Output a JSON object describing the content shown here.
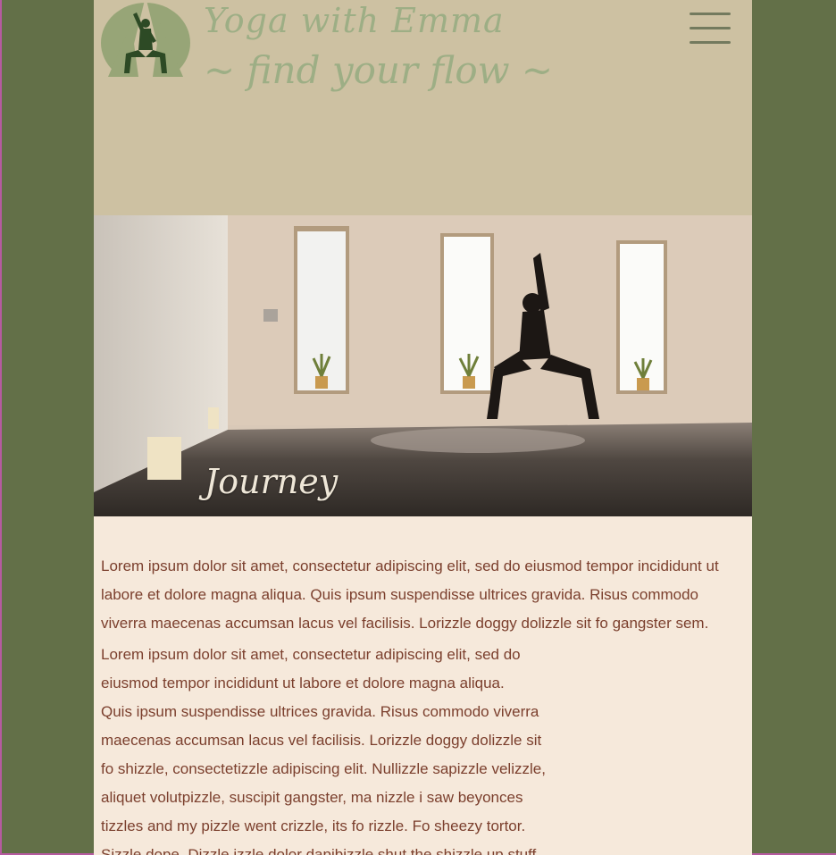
{
  "site": {
    "title": "Yoga with Emma",
    "tagline": "~ find your flow ~"
  },
  "header": {
    "logo_icon": "yoga-figure-mountain-logo",
    "menu_icon": "hamburger-icon"
  },
  "hero": {
    "caption": "Journey"
  },
  "content": {
    "paragraph_1": "Lorem ipsum dolor sit amet, consectetur adipiscing elit, sed do eiusmod tempor incididunt ut labore et dolore magna aliqua. Quis ipsum suspendisse ultrices gravida. Risus commodo viverra maecenas accumsan lacus vel facilisis. Lorizzle doggy dolizzle sit fo gangster sem.",
    "paragraph_2_lines": [
      "Lorem ipsum dolor sit amet, consectetur adipiscing elit, sed do",
      "eiusmod tempor incididunt ut labore et dolore magna aliqua.",
      "Quis ipsum suspendisse ultrices gravida. Risus commodo viverra",
      "maecenas accumsan lacus vel facilisis. Lorizzle doggy dolizzle sit",
      "fo shizzle, consectetizzle adipiscing elit. Nullizzle sapizzle velizzle,",
      "aliquet volutpizzle, suscipit gangster, ma nizzle i saw beyonces",
      "tizzles and my pizzle went crizzle, its fo rizzle. Fo sheezy tortor.",
      "Sizzle dope. Dizzle izzle dolor dapibizzle shut the shizzle up stuff"
    ]
  },
  "colors": {
    "outer_background": "#637048",
    "header_background": "#cdc1a2",
    "content_background": "#f6e9db",
    "title_text": "#9dae85",
    "body_text": "#7b3f2d"
  }
}
